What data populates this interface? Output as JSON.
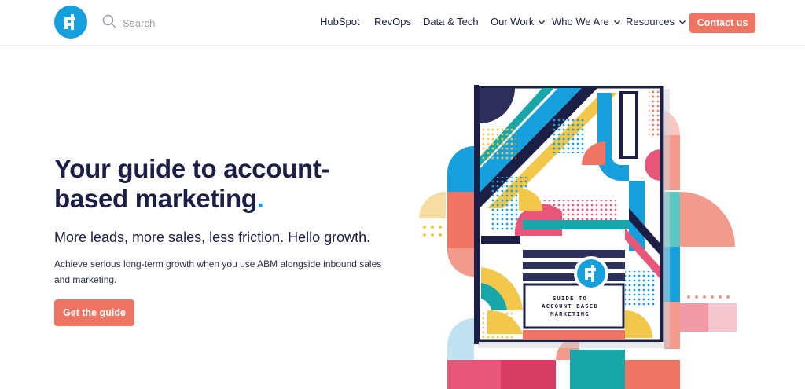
{
  "header": {
    "search_placeholder": "Search",
    "nav": [
      {
        "label": "HubSpot",
        "dropdown": false
      },
      {
        "label": "RevOps",
        "dropdown": false
      },
      {
        "label": "Data & Tech",
        "dropdown": false
      },
      {
        "label": "Our Work",
        "dropdown": true
      },
      {
        "label": "Who We Are",
        "dropdown": true
      },
      {
        "label": "Resources",
        "dropdown": true
      }
    ],
    "contact_label": "Contact us"
  },
  "hero": {
    "title_line1": "Your guide to account-",
    "title_line2": "based marketing",
    "title_dot": ".",
    "subtitle": "More leads, more sales, less friction. Hello growth.",
    "description": "Achieve serious long-term growth when you use ABM alongside inbound sales and marketing.",
    "cta_label": "Get the guide"
  },
  "book": {
    "label_line1": "GUIDE TO",
    "label_line2": "ACCOUNT BASED",
    "label_line3": "MARKETING"
  },
  "colors": {
    "brand_blue": "#15a0dd",
    "accent_coral": "#ef7462",
    "navy": "#1b1e45"
  },
  "icons": {
    "logo": "brand-logo-icon",
    "search": "search-icon",
    "dropdown": "chevron-down-icon"
  }
}
